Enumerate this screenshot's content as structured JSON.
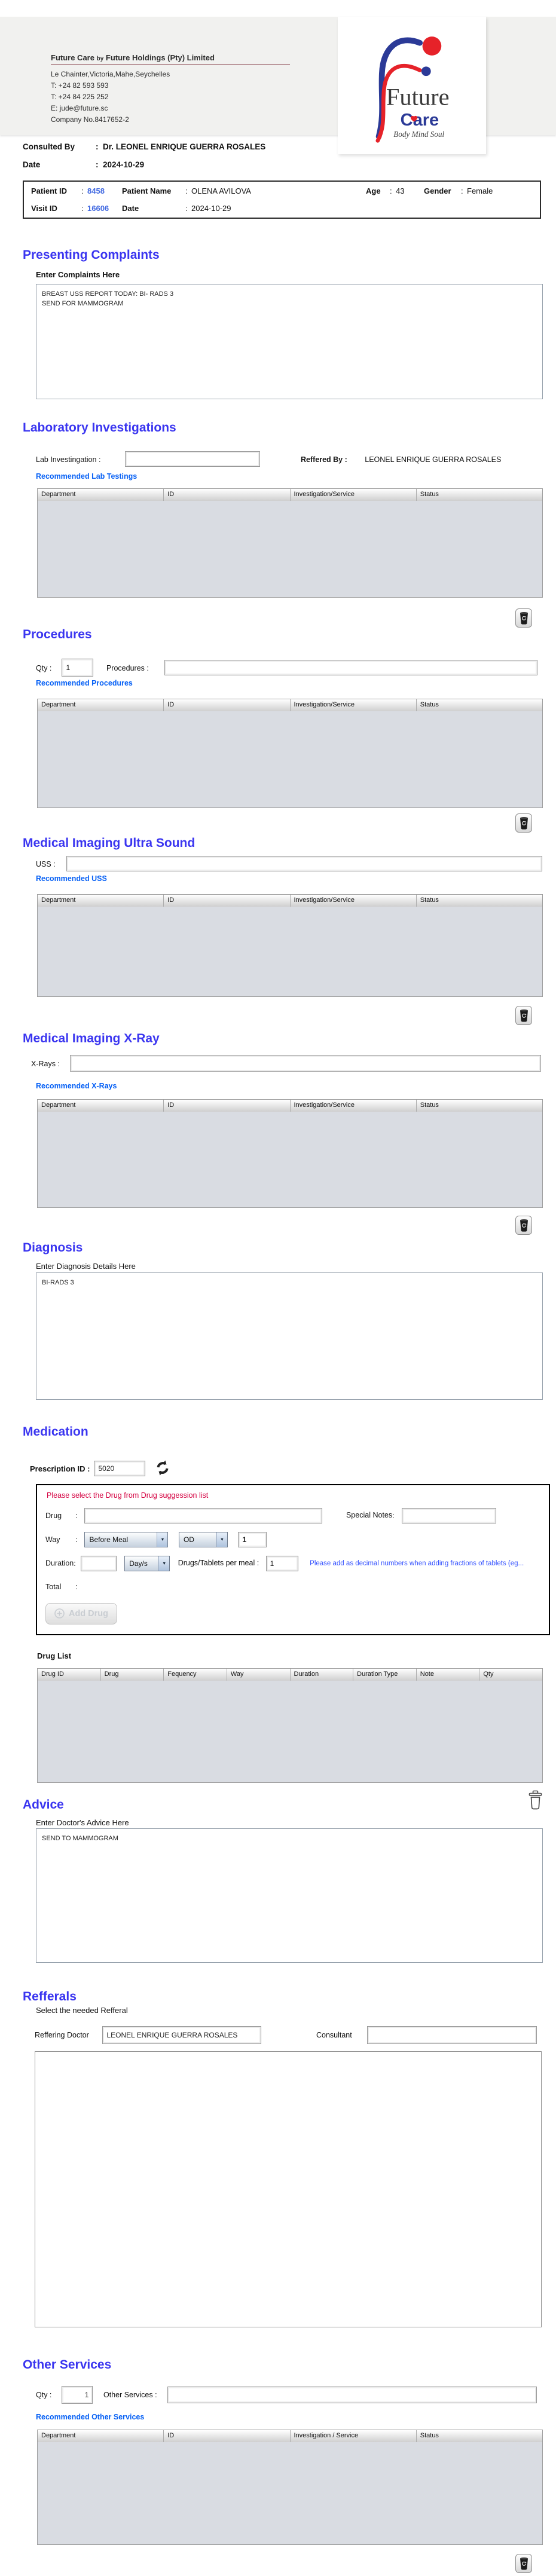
{
  "punct": {
    "colon": ":"
  },
  "colors": {
    "heading": "#3a35f0",
    "link": "#0660f5",
    "id_blue": "#4169e1",
    "warning_red": "#d40040",
    "hint_blue": "#2e4cff",
    "table_body": "#d9dce2",
    "logo_blue": "#2b3a97",
    "logo_red": "#e62229"
  },
  "header": {
    "company_name": "Future Care",
    "company_by": "by",
    "company_rest": "Future Holdings (Pty) Limited",
    "address": "Le Chainter,Victoria,Mahe,Seychelles",
    "phone1": "T: +24  82 593 593",
    "phone2": "T: +24  84 225 252",
    "email": "E: jude@future.sc",
    "company_no": "Company No.8417652-2",
    "logo_word1": "Future",
    "logo_word2": "Care",
    "logo_tagline": "Body Mind Soul"
  },
  "consult": {
    "consulted_by_label": "Consulted By",
    "consulted_by_value": "Dr.  LEONEL ENRIQUE GUERRA ROSALES",
    "date_label": "Date",
    "date_value": "2024-10-29"
  },
  "patient": {
    "id_label": "Patient ID",
    "id": "8458",
    "name_label": "Patient Name",
    "name": "OLENA AVILOVA",
    "age_label": "Age",
    "age": "43",
    "gender_label": "Gender",
    "gender": "Female",
    "visit_label": "Visit ID",
    "visit_id": "16606",
    "visit_date_label": "Date",
    "visit_date": "2024-10-29"
  },
  "complaints": {
    "title": "Presenting Complaints",
    "label": "Enter Complaints Here",
    "text": "BREAST USS REPORT TODAY: BI- RADS 3\nSEND FOR MAMMOGRAM"
  },
  "lab": {
    "title": "Laboratory  Investigations",
    "input_label": "Lab Investingation :",
    "input_value": "",
    "reffered_label": "Reffered By :",
    "reffered_value": "LEONEL ENRIQUE GUERRA ROSALES",
    "link": "Recommended Lab Testings",
    "headers": [
      "Department",
      "ID",
      "Investigation/Service",
      "Status"
    ]
  },
  "procedures": {
    "title": "Procedures",
    "qty_label": "Qty :",
    "qty_value": "1",
    "input_label": "Procedures :",
    "input_value": "",
    "link": "Recommended Procedures",
    "headers": [
      "Department",
      "ID",
      "Investigation/Service",
      "Status"
    ]
  },
  "uss": {
    "title": "Medical Imaging Ultra Sound",
    "input_label": "USS :",
    "input_value": "",
    "link": "Recommended USS",
    "headers": [
      "Department",
      "ID",
      "Investigation/Service",
      "Status"
    ]
  },
  "xray": {
    "title": "Medical Imaging X-Ray",
    "input_label": "X-Rays :",
    "input_value": "",
    "link": "Recommended X-Rays",
    "headers": [
      "Department",
      "ID",
      "Investigation/Service",
      "Status"
    ]
  },
  "diagnosis": {
    "title": "Diagnosis",
    "label": "Enter Diagnosis Details Here",
    "text": "BI-RADS 3"
  },
  "medication": {
    "title": "Medication",
    "prescription_label": "Prescription ID :",
    "prescription_id": "5020",
    "warning": "Please select the Drug from Drug suggession list",
    "drug_label": "Drug",
    "drug_value": "",
    "special_notes_label": "Special Notes",
    "special_notes_value": "",
    "way_label": "Way",
    "meal_select": "Before Meal",
    "frequency_select": "OD",
    "frequency_qty": "1",
    "duration_label": "Duration",
    "duration_value": "",
    "duration_unit_select": "Day/s",
    "per_meal_label": "Drugs/Tablets per meal :",
    "per_meal_value": "1",
    "fraction_hint": "Please add as decimal numbers when adding fractions of tablets (eg...",
    "total_label": "Total",
    "add_drug_label": "Add Drug",
    "drug_list_label": "Drug List",
    "drug_headers": [
      "Drug ID",
      "Drug",
      "Fequency",
      "Way",
      "Duration",
      "Duration Type",
      "Note",
      "Qty"
    ]
  },
  "advice": {
    "title": "Advice",
    "label": "Enter Doctor's Advice Here",
    "text": "SEND TO MAMMOGRAM"
  },
  "referrals": {
    "title": "Refferals",
    "subtitle": "Select the needed Refferal",
    "doctor_label": "Reffering Doctor",
    "doctor_value": "LEONEL ENRIQUE GUERRA ROSALES",
    "consultant_label": "Consultant",
    "consultant_value": ""
  },
  "other": {
    "title": "Other Services",
    "qty_label": "Qty :",
    "qty_value": "1",
    "input_label": "Other Services :",
    "input_value": "",
    "link": "Recommended Other Services",
    "headers": [
      "Department",
      "ID",
      "Investigation / Service",
      "Status"
    ]
  }
}
